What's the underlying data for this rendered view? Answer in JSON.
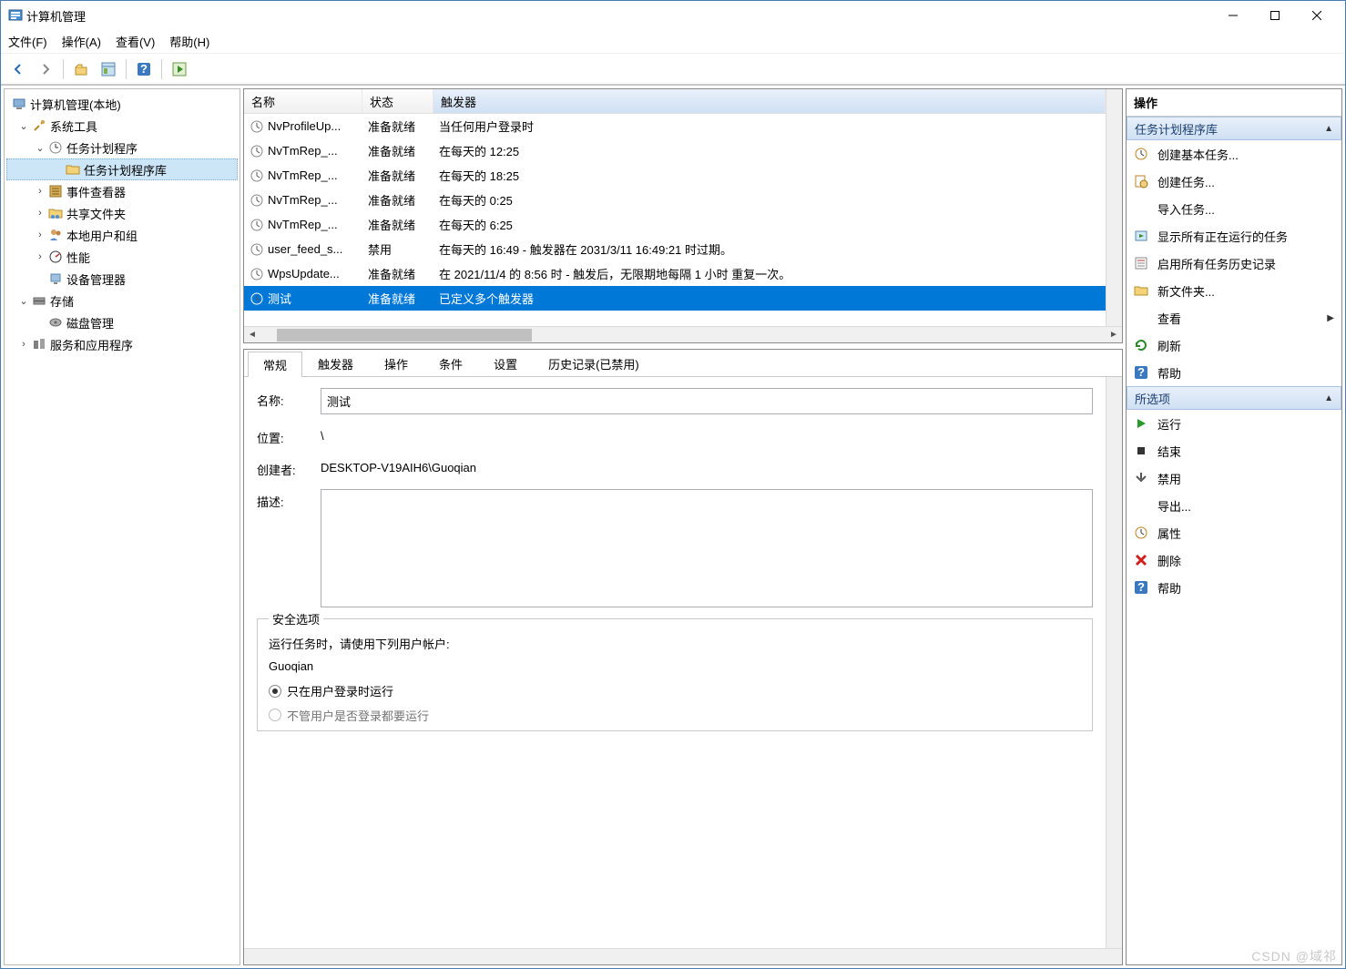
{
  "window": {
    "title": "计算机管理"
  },
  "menu": {
    "file": "文件(F)",
    "action": "操作(A)",
    "view": "查看(V)",
    "help": "帮助(H)"
  },
  "tree": {
    "root": "计算机管理(本地)",
    "systools": "系统工具",
    "scheduler": "任务计划程序",
    "scheduler_lib": "任务计划程序库",
    "eventviewer": "事件查看器",
    "shared": "共享文件夹",
    "localusers": "本地用户和组",
    "perf": "性能",
    "devmgr": "设备管理器",
    "storage": "存储",
    "diskmgmt": "磁盘管理",
    "services": "服务和应用程序"
  },
  "columns": {
    "name": "名称",
    "status": "状态",
    "trigger": "触发器"
  },
  "tasks": [
    {
      "name": "NvProfileUp...",
      "status": "准备就绪",
      "trigger": "当任何用户登录时"
    },
    {
      "name": "NvTmRep_...",
      "status": "准备就绪",
      "trigger": "在每天的 12:25"
    },
    {
      "name": "NvTmRep_...",
      "status": "准备就绪",
      "trigger": "在每天的 18:25"
    },
    {
      "name": "NvTmRep_...",
      "status": "准备就绪",
      "trigger": "在每天的 0:25"
    },
    {
      "name": "NvTmRep_...",
      "status": "准备就绪",
      "trigger": "在每天的 6:25"
    },
    {
      "name": "user_feed_s...",
      "status": "禁用",
      "trigger": "在每天的 16:49 - 触发器在 2031/3/11 16:49:21 时过期。"
    },
    {
      "name": "WpsUpdate...",
      "status": "准备就绪",
      "trigger": "在 2021/11/4 的 8:56 时 - 触发后，无限期地每隔 1 小时 重复一次。"
    },
    {
      "name": "测试",
      "status": "准备就绪",
      "trigger": "已定义多个触发器",
      "selected": true
    }
  ],
  "tabs": {
    "general": "常规",
    "triggers": "触发器",
    "actions": "操作",
    "conditions": "条件",
    "settings": "设置",
    "history": "历史记录(已禁用)"
  },
  "detail": {
    "name_label": "名称:",
    "name_value": "测试",
    "loc_label": "位置:",
    "loc_value": "\\",
    "author_label": "创建者:",
    "author_value": "DESKTOP-V19AIH6\\Guoqian",
    "desc_label": "描述:",
    "security_title": "安全选项",
    "security_line1": "运行任务时，请使用下列用户帐户:",
    "user": "Guoqian",
    "radio1": "只在用户登录时运行",
    "radio2_partial": "不管用户是否登录都要运行"
  },
  "actions_head": "操作",
  "actions1": {
    "title": "任务计划程序库",
    "create_basic": "创建基本任务...",
    "create_task": "创建任务...",
    "import": "导入任务...",
    "show_running": "显示所有正在运行的任务",
    "enable_history": "启用所有任务历史记录",
    "new_folder": "新文件夹...",
    "view": "查看",
    "refresh": "刷新",
    "help": "帮助"
  },
  "actions2": {
    "title": "所选项",
    "run": "运行",
    "end": "结束",
    "disable": "禁用",
    "export": "导出...",
    "properties": "属性",
    "delete": "删除",
    "help": "帮助"
  },
  "watermark": "CSDN @域祁"
}
